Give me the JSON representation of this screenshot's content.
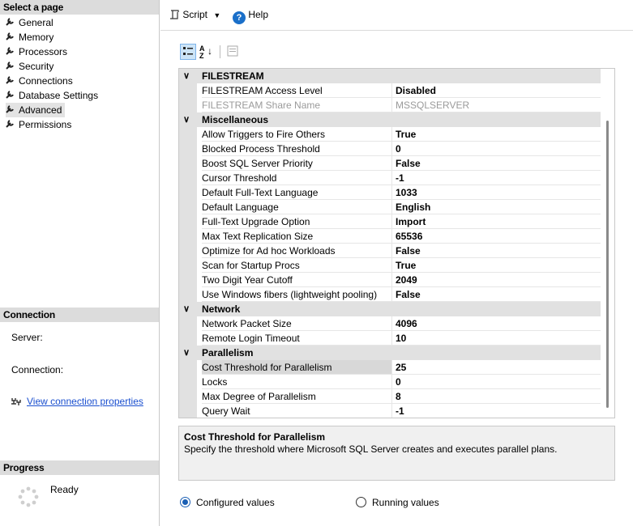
{
  "left_panel": {
    "select_page_header": "Select a page",
    "pages": [
      {
        "label": "General"
      },
      {
        "label": "Memory"
      },
      {
        "label": "Processors"
      },
      {
        "label": "Security"
      },
      {
        "label": "Connections"
      },
      {
        "label": "Database Settings"
      },
      {
        "label": "Advanced"
      },
      {
        "label": "Permissions"
      }
    ],
    "selected_page": "Advanced",
    "connection_header": "Connection",
    "server_label": "Server:",
    "connection_label": "Connection:",
    "view_connection_link": "View connection properties",
    "progress_header": "Progress",
    "progress_status": "Ready"
  },
  "toolbar": {
    "script_label": "Script",
    "help_label": "Help"
  },
  "grid": {
    "categories": [
      {
        "title": "FILESTREAM",
        "rows": [
          {
            "name": "FILESTREAM Access Level",
            "value": "Disabled",
            "disabled": false
          },
          {
            "name": "FILESTREAM Share Name",
            "value": "MSSQLSERVER",
            "disabled": true
          }
        ]
      },
      {
        "title": "Miscellaneous",
        "rows": [
          {
            "name": "Allow Triggers to Fire Others",
            "value": "True"
          },
          {
            "name": "Blocked Process Threshold",
            "value": "0"
          },
          {
            "name": "Boost SQL Server Priority",
            "value": "False"
          },
          {
            "name": "Cursor Threshold",
            "value": "-1"
          },
          {
            "name": "Default Full-Text Language",
            "value": "1033"
          },
          {
            "name": "Default Language",
            "value": "English"
          },
          {
            "name": "Full-Text Upgrade Option",
            "value": "Import"
          },
          {
            "name": "Max Text Replication Size",
            "value": "65536"
          },
          {
            "name": "Optimize for Ad hoc Workloads",
            "value": "False"
          },
          {
            "name": "Scan for Startup Procs",
            "value": "True"
          },
          {
            "name": "Two Digit Year Cutoff",
            "value": "2049"
          },
          {
            "name": "Use Windows fibers (lightweight pooling)",
            "value": "False"
          }
        ]
      },
      {
        "title": "Network",
        "rows": [
          {
            "name": "Network Packet Size",
            "value": "4096"
          },
          {
            "name": "Remote Login Timeout",
            "value": "10"
          }
        ]
      },
      {
        "title": "Parallelism",
        "rows": [
          {
            "name": "Cost Threshold for Parallelism",
            "value": "25",
            "selected": true
          },
          {
            "name": "Locks",
            "value": "0"
          },
          {
            "name": "Max Degree of Parallelism",
            "value": "8"
          },
          {
            "name": "Query Wait",
            "value": "-1"
          }
        ]
      }
    ]
  },
  "description": {
    "title": "Cost Threshold for Parallelism",
    "text": "Specify the threshold where Microsoft SQL Server creates and executes parallel plans."
  },
  "options": {
    "configured_label": "Configured values",
    "running_label": "Running values",
    "selected": "configured"
  },
  "colors": {
    "accent": "#1a5fb4",
    "link": "#1a4fcf",
    "header_bg": "#dcdcdc"
  }
}
